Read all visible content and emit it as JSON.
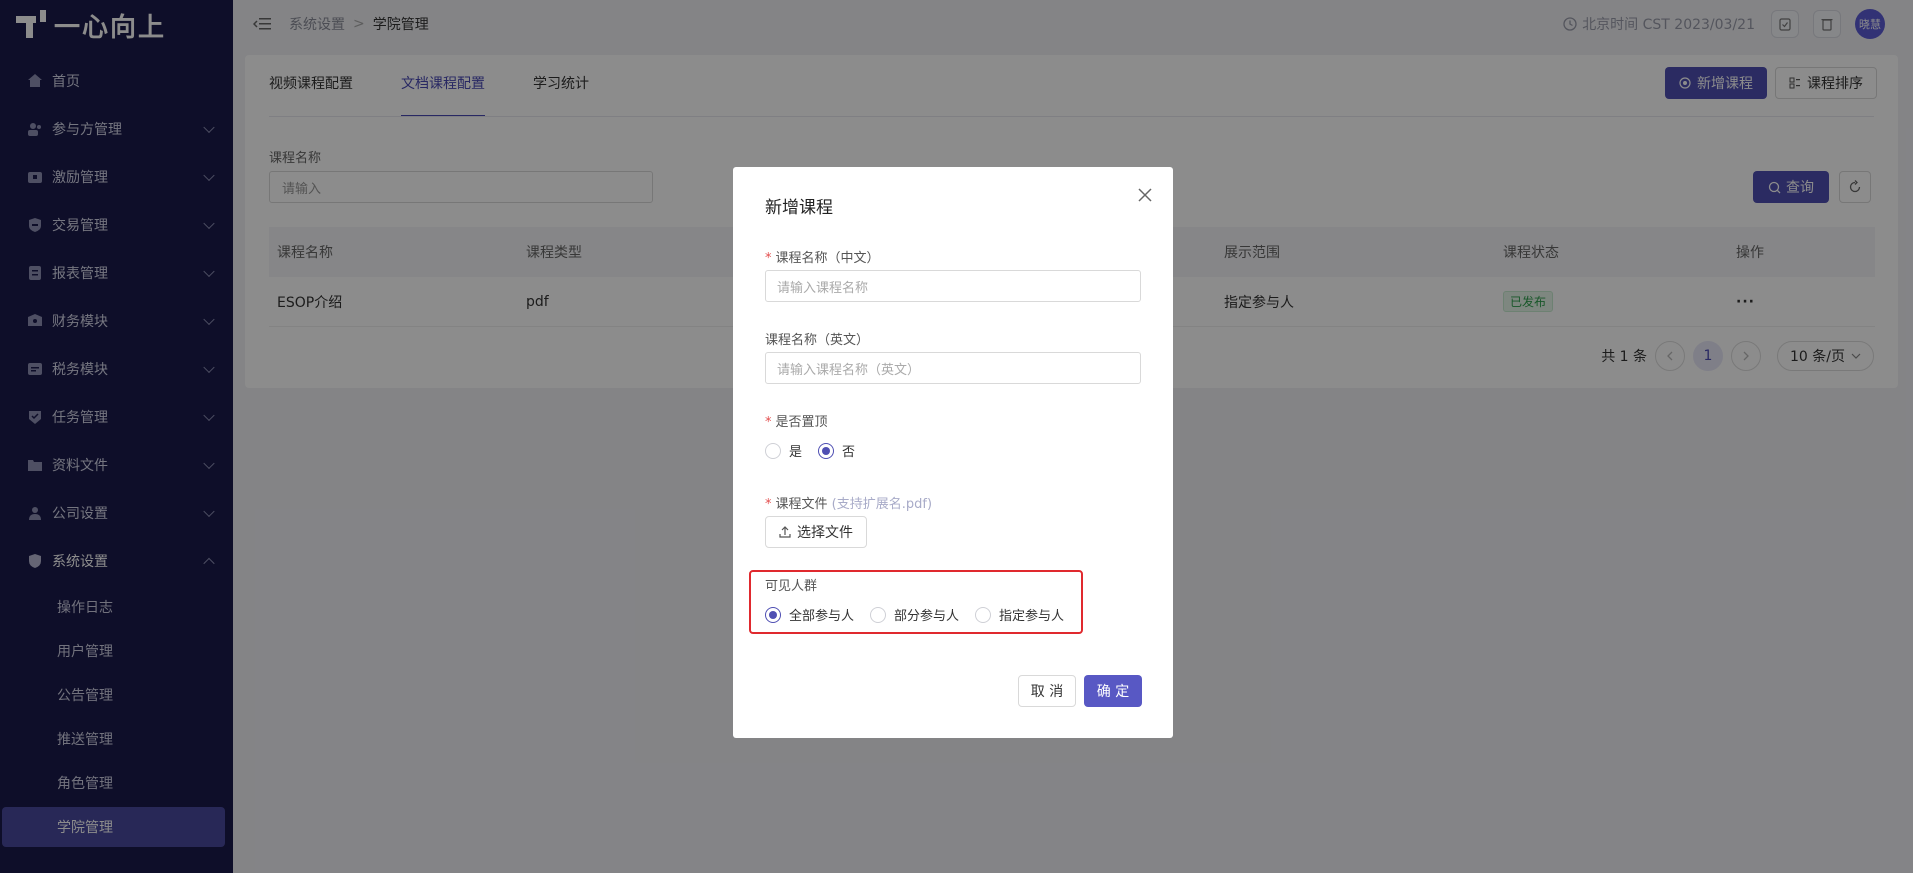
{
  "brand": {
    "name": "一心向上"
  },
  "sidebar": {
    "items": [
      {
        "label": "首页",
        "icon": "home-icon",
        "expandable": false
      },
      {
        "label": "参与方管理",
        "icon": "users-icon",
        "expandable": true
      },
      {
        "label": "激励管理",
        "icon": "gift-icon",
        "expandable": true
      },
      {
        "label": "交易管理",
        "icon": "exchange-icon",
        "expandable": true
      },
      {
        "label": "报表管理",
        "icon": "report-icon",
        "expandable": true
      },
      {
        "label": "财务模块",
        "icon": "wallet-icon",
        "expandable": true
      },
      {
        "label": "税务模块",
        "icon": "tax-icon",
        "expandable": true
      },
      {
        "label": "任务管理",
        "icon": "task-icon",
        "expandable": true
      },
      {
        "label": "资料文件",
        "icon": "folder-icon",
        "expandable": true
      },
      {
        "label": "公司设置",
        "icon": "company-icon",
        "expandable": true
      },
      {
        "label": "系统设置",
        "icon": "shield-icon",
        "expandable": true,
        "expanded": true
      }
    ],
    "sub_items": [
      "操作日志",
      "用户管理",
      "公告管理",
      "推送管理",
      "角色管理",
      "学院管理"
    ],
    "active_sub": "学院管理"
  },
  "header": {
    "breadcrumb": [
      "系统设置",
      "学院管理"
    ],
    "time": "北京时间 CST 2023/03/21",
    "user_avatar": "晓慧"
  },
  "tabs": [
    "视频课程配置",
    "文档课程配置",
    "学习统计"
  ],
  "active_tab": "文档课程配置",
  "toolbar": {
    "add_label": "新增课程",
    "sort_label": "课程排序"
  },
  "filter": {
    "label": "课程名称",
    "placeholder": "请输入",
    "query_label": "查询"
  },
  "table": {
    "columns": [
      "课程名称",
      "课程类型",
      "展示范围",
      "课程状态",
      "操作"
    ],
    "rows": [
      {
        "name": "ESOP介绍",
        "type": "pdf",
        "scope": "指定参与人",
        "status": "已发布",
        "actions": "···"
      }
    ]
  },
  "pagination": {
    "total_text": "共 1 条",
    "current_page": "1",
    "page_size": "10 条/页"
  },
  "modal": {
    "title": "新增课程",
    "name_cn": {
      "label": "课程名称（中文）",
      "placeholder": "请输入课程名称"
    },
    "name_en": {
      "label": "课程名称（英文）",
      "placeholder": "请输入课程名称（英文）"
    },
    "pin": {
      "label": "是否置顶",
      "options": [
        "是",
        "否"
      ],
      "selected": "否"
    },
    "file": {
      "label": "课程文件",
      "hint": "(支持扩展名.pdf)",
      "button": "选择文件"
    },
    "audience": {
      "label": "可见人群",
      "options": [
        "全部参与人",
        "部分参与人",
        "指定参与人"
      ],
      "selected": "全部参与人"
    },
    "cancel": "取 消",
    "ok": "确 定"
  },
  "colors": {
    "primary": "#4f4fb3",
    "sidebar_bg": "#1a1a4b",
    "highlight": "#e0292e"
  }
}
